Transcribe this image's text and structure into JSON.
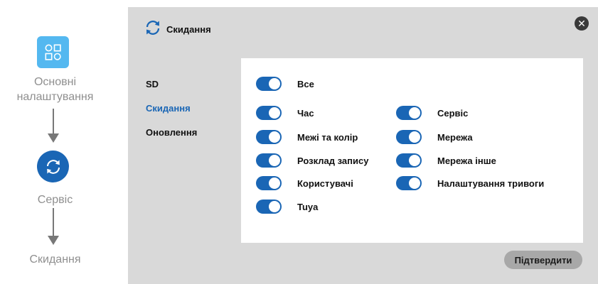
{
  "flow": {
    "steps": [
      {
        "label": "Основні налаштування",
        "icon": "settings-grid-icon"
      },
      {
        "label": "Сервіс",
        "icon": "refresh-icon"
      },
      {
        "label": "Скидання"
      }
    ]
  },
  "dialog": {
    "title": "Скидання",
    "title_icon": "refresh-icon",
    "close_icon": "close-icon",
    "close_symbol": "✕",
    "menu": [
      {
        "label": "SD",
        "active": false
      },
      {
        "label": "Скидання",
        "active": true
      },
      {
        "label": "Оновлення",
        "active": false
      }
    ],
    "toggles": {
      "all": {
        "label": "Все",
        "on": true
      },
      "left": [
        {
          "label": "Час",
          "on": true
        },
        {
          "label": "Межі та колір",
          "on": true
        },
        {
          "label": "Розклад запису",
          "on": true
        },
        {
          "label": "Користувачі",
          "on": true
        },
        {
          "label": "Tuya",
          "on": true
        }
      ],
      "right": [
        {
          "label": "Сервіс",
          "on": true
        },
        {
          "label": "Мережа",
          "on": true
        },
        {
          "label": "Мережа інше",
          "on": true
        },
        {
          "label": "Налаштування тривоги",
          "on": true
        }
      ]
    },
    "confirm_label": "Підтвердити"
  },
  "colors": {
    "accent": "#1a66b5",
    "light_accent": "#54b8f0",
    "dialog_bg": "#d9d9d9",
    "panel_bg": "#ffffff",
    "button_bg": "#a8a8a8",
    "muted_text": "#8f8f8f"
  }
}
